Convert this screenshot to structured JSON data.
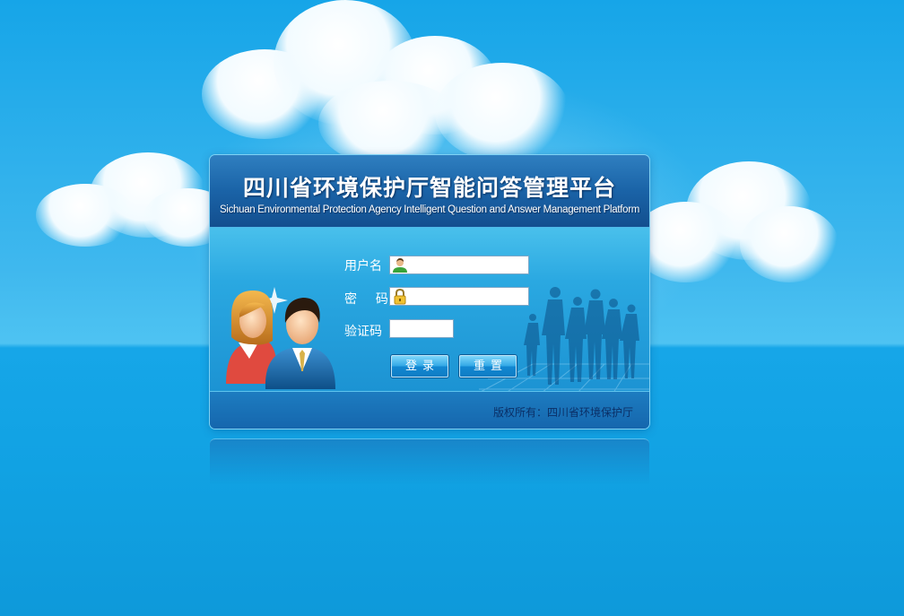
{
  "header": {
    "title_cn": "四川省环境保护厅智能问答管理平台",
    "title_en": "Sichuan Environmental Protection Agency Intelligent Question and Answer Management Platform"
  },
  "form": {
    "username_label": "用户名",
    "username_value": "",
    "password_label": "密  码",
    "password_value": "",
    "captcha_label": "验证码",
    "captcha_value": "",
    "login_button": "登录",
    "reset_button": "重置",
    "username_icon": "user-icon",
    "password_icon": "lock-icon"
  },
  "footer": {
    "copyright": "版权所有：四川省环境保护厅"
  },
  "colors": {
    "sky": "#16a5e8",
    "header": "#134f8f",
    "panel_body": "#2aa8e1",
    "footer": "#1566ad",
    "copyright_text": "#0b2f66"
  }
}
